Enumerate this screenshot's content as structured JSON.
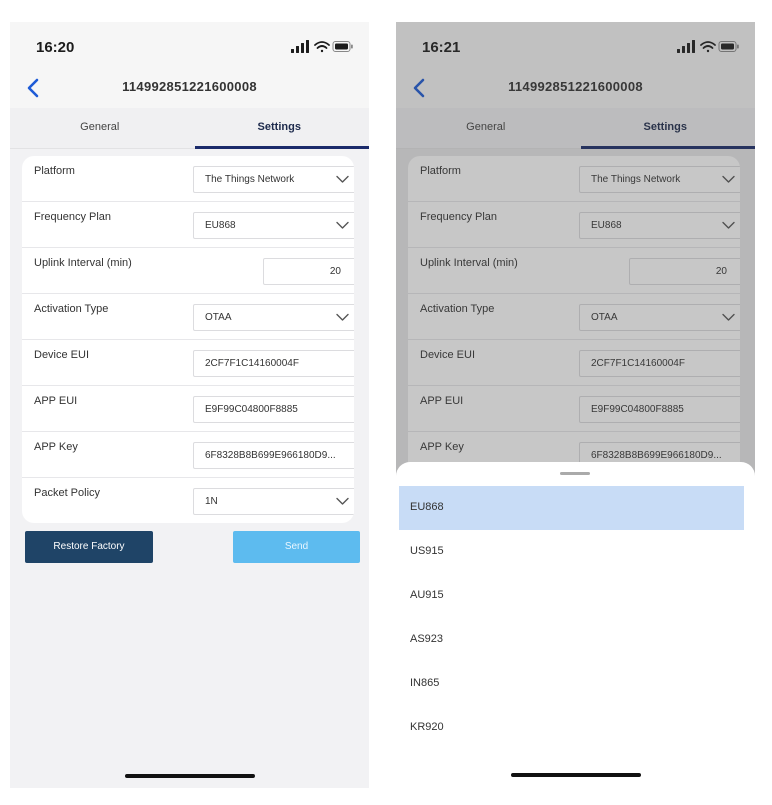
{
  "left": {
    "status": {
      "time": "16:20"
    },
    "nav": {
      "title": "114992851221600008"
    },
    "tabs": {
      "general": "General",
      "settings": "Settings"
    },
    "fields": [
      {
        "label": "Platform",
        "value": "The Things Network",
        "type": "select"
      },
      {
        "label": "Frequency Plan",
        "value": "EU868",
        "type": "select"
      },
      {
        "label": "Uplink Interval (min)",
        "value": "20",
        "type": "number"
      },
      {
        "label": "Activation Type",
        "value": "OTAA",
        "type": "select"
      },
      {
        "label": "Device EUI",
        "value": "2CF7F1C14160004F",
        "type": "text"
      },
      {
        "label": "APP EUI",
        "value": "E9F99C04800F8885",
        "type": "text"
      },
      {
        "label": "APP Key",
        "value": "6F8328B8B699E966180D9...",
        "type": "text"
      },
      {
        "label": "Packet Policy",
        "value": "1N",
        "type": "select"
      }
    ],
    "buttons": {
      "restore": "Restore Factory",
      "send": "Send"
    }
  },
  "right": {
    "status": {
      "time": "16:21"
    },
    "nav": {
      "title": "114992851221600008"
    },
    "tabs": {
      "general": "General",
      "settings": "Settings"
    },
    "fields": [
      {
        "label": "Platform",
        "value": "The Things Network",
        "type": "select"
      },
      {
        "label": "Frequency Plan",
        "value": "EU868",
        "type": "select"
      },
      {
        "label": "Uplink Interval (min)",
        "value": "20",
        "type": "number"
      },
      {
        "label": "Activation Type",
        "value": "OTAA",
        "type": "select"
      },
      {
        "label": "Device EUI",
        "value": "2CF7F1C14160004F",
        "type": "text"
      },
      {
        "label": "APP EUI",
        "value": "E9F99C04800F8885",
        "type": "text"
      },
      {
        "label": "APP Key",
        "value": "6F8328B8B699E966180D9...",
        "type": "text"
      }
    ],
    "sheet": {
      "options": [
        "EU868",
        "US915",
        "AU915",
        "AS923",
        "IN865",
        "KR920"
      ],
      "selected": "EU868"
    }
  },
  "colors": {
    "tab_underline": "#1b2b6b",
    "restore_button": "#1f4467",
    "send_button": "#5dbbef",
    "selected_option": "#c8dcf6",
    "back_chevron": "#1e5bd6"
  },
  "icons": [
    "back-chevron-icon",
    "location-arrow-icon",
    "cellular-signal-icon",
    "wifi-icon",
    "battery-icon",
    "chevron-down-icon"
  ]
}
